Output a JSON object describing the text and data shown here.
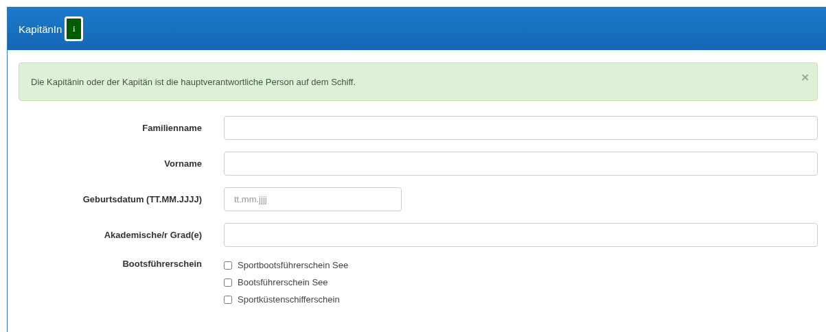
{
  "panel": {
    "title": "KapitänIn",
    "info_badge": "i"
  },
  "alert": {
    "text": "Die Kapitänin oder der Kapitän ist die hauptverantwortliche Person auf dem Schiff.",
    "close": "×"
  },
  "fields": [
    {
      "kind": "text",
      "label": "Familienname"
    },
    {
      "kind": "text",
      "label": "Vorname"
    },
    {
      "kind": "date",
      "label": "Geburtsdatum (TT.MM.JJJJ)",
      "placeholder": "tt.mm.jjjj"
    },
    {
      "kind": "text",
      "label": "Akademische/r Grad(e)"
    },
    {
      "kind": "checkboxes",
      "label": "Bootsführerschein",
      "options": [
        {
          "label": "Sportbootsführerschein See",
          "checked": false
        },
        {
          "label": "Bootsführerschein See",
          "checked": false
        },
        {
          "label": "Sportküstenschifferschein",
          "checked": false
        }
      ]
    }
  ]
}
